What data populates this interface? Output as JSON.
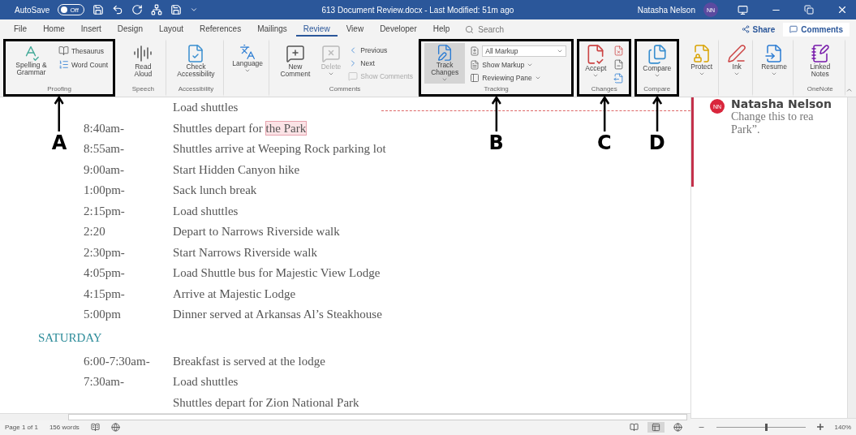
{
  "title_bar": {
    "autosave_label": "AutoSave",
    "autosave_toggle": {
      "label": "Off",
      "on": false
    },
    "document_title": "613 Document Review.docx - Last Modified: 51m ago",
    "user_name": "Natasha Nelson",
    "user_initials": "NN"
  },
  "tabs": [
    {
      "label": "File",
      "selected": false
    },
    {
      "label": "Home",
      "selected": false
    },
    {
      "label": "Insert",
      "selected": false
    },
    {
      "label": "Design",
      "selected": false
    },
    {
      "label": "Layout",
      "selected": false
    },
    {
      "label": "References",
      "selected": false
    },
    {
      "label": "Mailings",
      "selected": false
    },
    {
      "label": "Review",
      "selected": true
    },
    {
      "label": "View",
      "selected": false
    },
    {
      "label": "Developer",
      "selected": false
    },
    {
      "label": "Help",
      "selected": false
    }
  ],
  "search": {
    "placeholder": "Search"
  },
  "share_button": "Share",
  "comments_button": "Comments",
  "ribbon_groups": [
    {
      "label": "Proofing",
      "annotation": "A",
      "items": [
        {
          "kind": "large",
          "label": "Spelling & Grammar",
          "disabled": false
        },
        {
          "kind": "small",
          "label": "Thesaurus",
          "disabled": false
        },
        {
          "kind": "small",
          "label": "Word Count",
          "disabled": false
        }
      ]
    },
    {
      "label": "Speech",
      "items": [
        {
          "kind": "large",
          "label": "Read Aloud",
          "disabled": false
        }
      ]
    },
    {
      "label": "Accessibility",
      "items": [
        {
          "kind": "large",
          "label": "Check Accessibility",
          "disabled": false
        }
      ]
    },
    {
      "items": [
        {
          "kind": "large",
          "label": "Language",
          "dropdown": true,
          "disabled": false
        }
      ]
    },
    {
      "label": "Comments",
      "items": [
        {
          "kind": "large",
          "label": "New Comment",
          "disabled": false
        },
        {
          "kind": "large",
          "label": "Delete",
          "dropdown": true,
          "disabled": true
        },
        {
          "kind": "small",
          "label": "Previous",
          "disabled": false
        },
        {
          "kind": "small",
          "label": "Next",
          "disabled": false
        },
        {
          "kind": "small",
          "label": "Show Comments",
          "disabled": true
        }
      ]
    },
    {
      "label": "Tracking",
      "annotation": "B",
      "items": [
        {
          "kind": "large",
          "label": "Track Changes",
          "pressed": true,
          "dropdown": true,
          "disabled": false
        },
        {
          "kind": "select",
          "label": "All Markup",
          "disabled": false
        },
        {
          "kind": "small",
          "label": "Show Markup",
          "dropdown": true,
          "disabled": false
        },
        {
          "kind": "small",
          "label": "Reviewing Pane",
          "dropdown": true,
          "disabled": false
        }
      ]
    },
    {
      "label": "Changes",
      "annotation": "C",
      "items": [
        {
          "kind": "large",
          "label": "Accept",
          "dropdown": true,
          "disabled": false
        },
        {
          "kind": "icon",
          "disabled": false
        },
        {
          "kind": "icon",
          "disabled": false
        },
        {
          "kind": "icon",
          "disabled": false
        }
      ]
    },
    {
      "label": "Compare",
      "annotation": "D",
      "items": [
        {
          "kind": "large",
          "label": "Compare",
          "dropdown": true,
          "disabled": false
        }
      ]
    },
    {
      "items": [
        {
          "kind": "large",
          "label": "Protect",
          "dropdown": true,
          "disabled": false
        }
      ]
    },
    {
      "items": [
        {
          "kind": "large",
          "label": "Ink",
          "dropdown": true,
          "disabled": false
        }
      ]
    },
    {
      "items": [
        {
          "kind": "large",
          "label": "Resume",
          "dropdown": true,
          "disabled": false
        }
      ]
    },
    {
      "label": "OneNote",
      "items": [
        {
          "kind": "large",
          "label": "Linked Notes",
          "disabled": false
        }
      ]
    }
  ],
  "document": {
    "sections": [
      {
        "rows": [
          {
            "activity": "Load shuttles"
          },
          {
            "time": "8:40am-",
            "activity": "Shuttles depart for ",
            "commented_text": "the Park"
          },
          {
            "time": "8:55am-",
            "activity": "Shuttles arrive at Weeping Rock parking lot"
          },
          {
            "time": "9:00am-",
            "activity": "Start Hidden Canyon hike"
          },
          {
            "time": "1:00pm-",
            "activity": "Sack lunch break"
          },
          {
            "time": "2:15pm-",
            "activity": "Load shuttles"
          },
          {
            "time": "2:20",
            "activity": "Depart to Narrows Riverside walk"
          },
          {
            "time": "2:30pm-",
            "activity": "Start Narrows Riverside walk"
          },
          {
            "time": "4:05pm-",
            "activity": "Load Shuttle bus for Majestic View Lodge"
          },
          {
            "time": "4:15pm-",
            "activity": "Arrive at Majestic Lodge"
          },
          {
            "time": "5:00pm",
            "activity": "Dinner served at Arkansas Al’s Steakhouse"
          }
        ]
      },
      {
        "heading": "SATURDAY",
        "rows": [
          {
            "time": "6:00-7:30am-",
            "activity": "Breakfast is served at the lodge"
          },
          {
            "time": "7:30am-",
            "activity": "Load shuttles"
          },
          {
            "activity": "Shuttles depart for Zion National Park"
          }
        ]
      }
    ]
  },
  "comment": {
    "author": "Natasha Nelson",
    "initials": "NN",
    "lines": [
      "Change this to rea",
      "Park”."
    ]
  },
  "status_bar": {
    "page": "Page 1 of 1",
    "words": "156 words",
    "views": [
      {
        "selected": false
      },
      {
        "selected": true
      },
      {
        "selected": false
      }
    ],
    "zoom": {
      "level": 0.55,
      "reading": "140%"
    }
  }
}
